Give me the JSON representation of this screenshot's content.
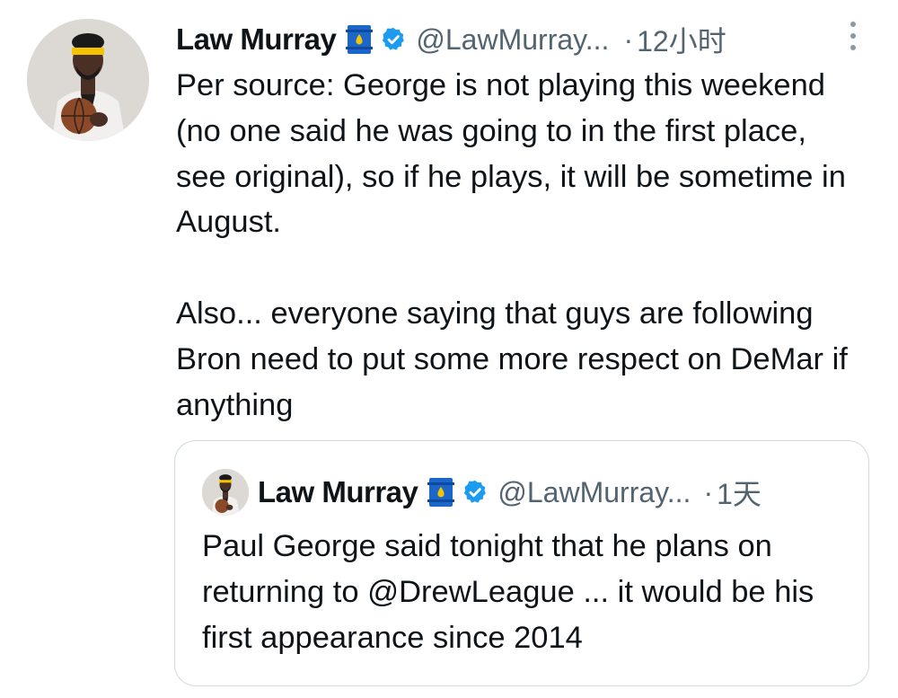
{
  "tweet": {
    "author_name": "Law Murray",
    "handle": "@LawMurray...",
    "time_separator": "·",
    "time": "12小时",
    "paragraphs": [
      "Per source: George is not playing this weekend (no one said he was going to in the first place, see original), so if he plays, it will be sometime in August.",
      "Also... everyone saying that guys are following Bron need to put some more respect on DeMar if anything"
    ]
  },
  "quoted_tweet": {
    "author_name": "Law Murray",
    "handle": "@LawMurray...",
    "time_separator": "·",
    "time": "1天",
    "text": "Paul George said tonight that he plans on returning to @DrewLeague ... it would be his first appearance since 2014"
  },
  "icons": {
    "avatar": "profile-photo",
    "badge": "oil-barrel-icon",
    "verified": "verified-badge-icon",
    "more": "more-vertical-icon"
  },
  "colors": {
    "text": "#0f1419",
    "secondary": "#536471",
    "verified_blue": "#1d9bf0",
    "barrel_blue": "#1a66c9",
    "barrel_yellow": "#f5c400",
    "border": "#cfd9de"
  }
}
